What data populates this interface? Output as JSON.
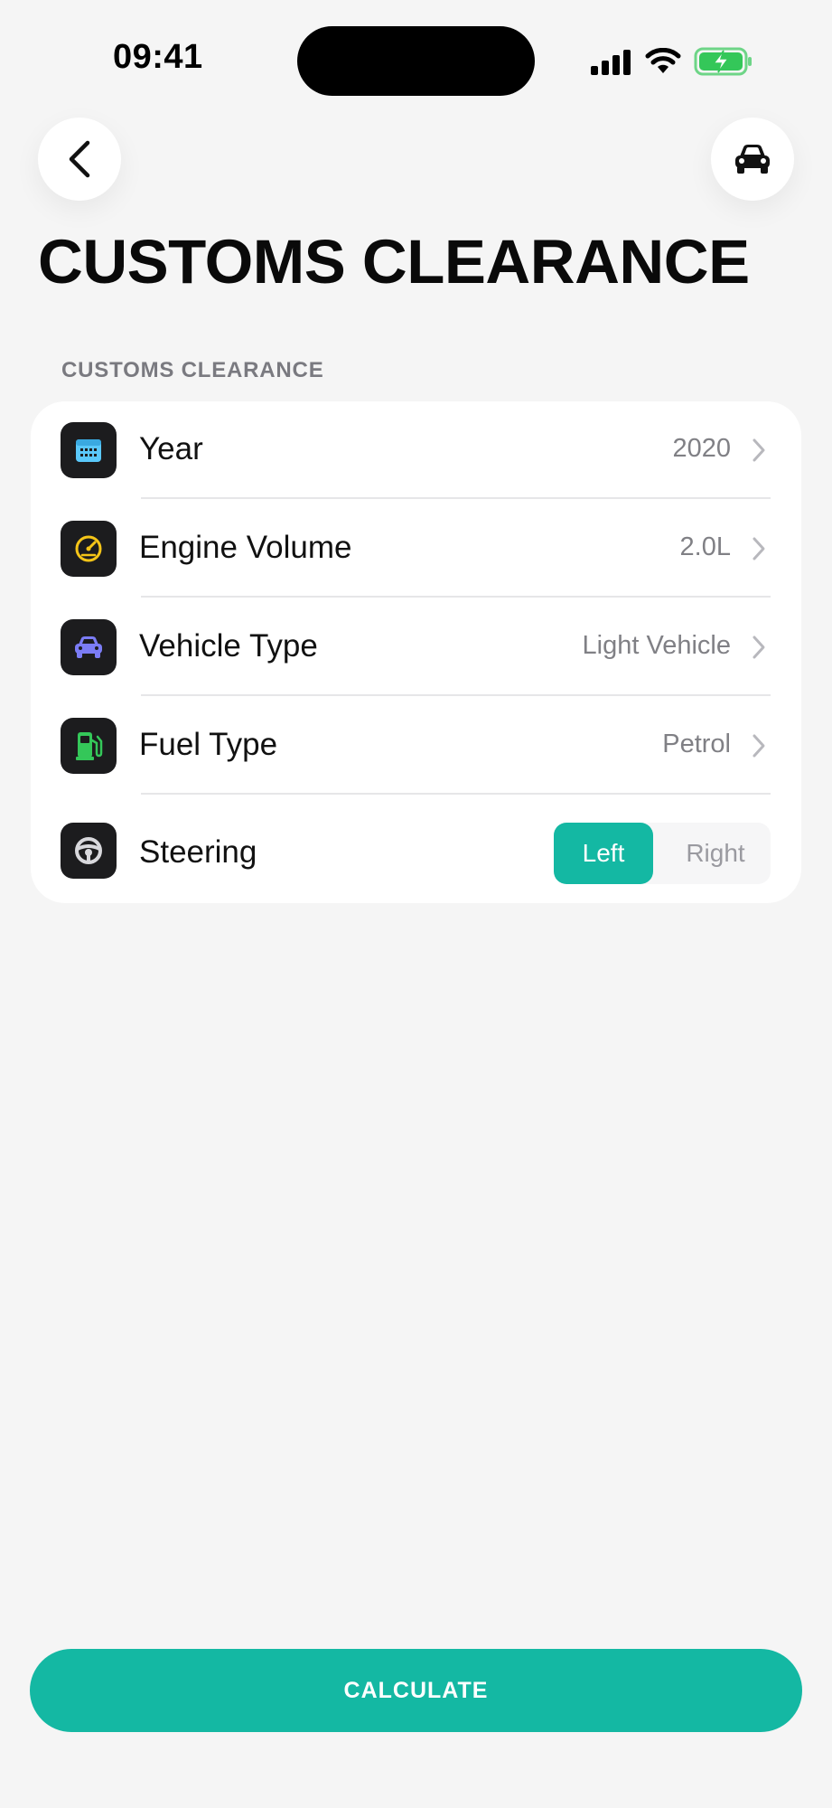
{
  "status_bar": {
    "time": "09:41"
  },
  "header": {
    "title": "CUSTOMS CLEARANCE"
  },
  "section": {
    "label": "CUSTOMS CLEARANCE"
  },
  "rows": [
    {
      "label": "Year",
      "value": "2020",
      "icon": "calendar-icon",
      "icon_color": "#5ac8fa"
    },
    {
      "label": "Engine Volume",
      "value": "2.0L",
      "icon": "speedometer-icon",
      "icon_color": "#f5c518"
    },
    {
      "label": "Vehicle Type",
      "value": "Light Vehicle",
      "icon": "car-icon",
      "icon_color": "#7b7cf5"
    },
    {
      "label": "Fuel Type",
      "value": "Petrol",
      "icon": "fuel-pump-icon",
      "icon_color": "#34c759"
    }
  ],
  "steering": {
    "label": "Steering",
    "icon": "steering-wheel-icon",
    "options": [
      "Left",
      "Right"
    ],
    "selected": "Left"
  },
  "calculate": {
    "label": "CALCULATE"
  },
  "colors": {
    "accent": "#14b8a3",
    "background": "#f5f5f5",
    "icon_tile": "#1c1c1e"
  }
}
